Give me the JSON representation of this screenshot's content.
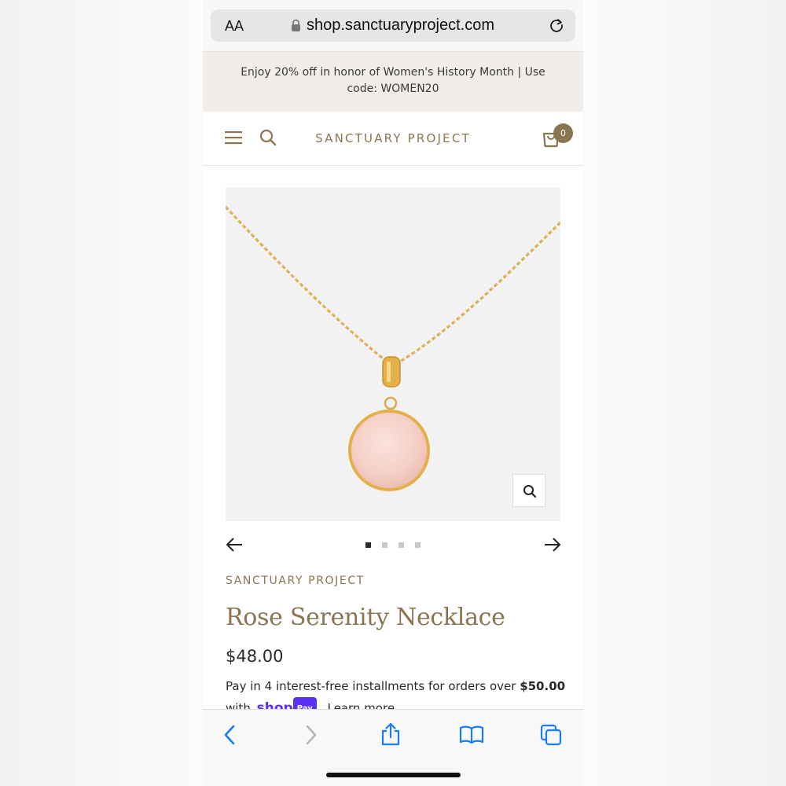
{
  "browser": {
    "text_size_label": "AA",
    "url": "shop.sanctuaryproject.com"
  },
  "promo": {
    "text": "Enjoy 20% off in honor of Women's History Month | Use code: WOMEN20"
  },
  "header": {
    "brand": "SANCTUARY PROJECT",
    "cart_count": "0"
  },
  "gallery": {
    "slide_count": 4,
    "active_slide": 1
  },
  "product": {
    "vendor": "SANCTUARY PROJECT",
    "title": "Rose Serenity Necklace",
    "price": "$48.00",
    "installments_prefix": "Pay in 4 interest-free installments for orders over",
    "installments_threshold": "$50.00",
    "installments_with": "with",
    "shop_pay_logo_text": "shop",
    "shop_pay_pill_text": "Pay",
    "learn_more": "Learn more"
  },
  "colors": {
    "brand_gold": "#8a7550",
    "shop_pay_purple": "#5a31f4",
    "ios_blue": "#1a7cf2"
  }
}
